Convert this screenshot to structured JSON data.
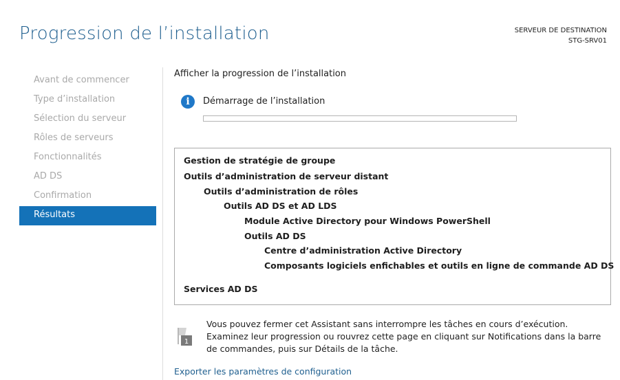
{
  "header": {
    "title": "Progression de l’installation",
    "server_label": "SERVEUR DE DESTINATION",
    "server_name": "STG-SRV01"
  },
  "nav": {
    "items": [
      {
        "label": "Avant de commencer"
      },
      {
        "label": "Type d’installation"
      },
      {
        "label": "Sélection du serveur"
      },
      {
        "label": "Rôles de serveurs"
      },
      {
        "label": "Fonctionnalités"
      },
      {
        "label": "AD DS"
      },
      {
        "label": "Confirmation"
      },
      {
        "label": "Résultats"
      }
    ],
    "active_index": 7
  },
  "main": {
    "section_label": "Afficher la progression de l’installation",
    "status_text": "Démarrage de l’installation",
    "progress": 0,
    "features": [
      {
        "label": "Gestion de stratégie de groupe",
        "level": 0
      },
      {
        "label": "Outils d’administration de serveur distant",
        "level": 0
      },
      {
        "label": "Outils d’administration de rôles",
        "level": 1
      },
      {
        "label": "Outils AD DS et AD LDS",
        "level": 2
      },
      {
        "label": "Module Active Directory pour Windows PowerShell",
        "level": 3
      },
      {
        "label": "Outils AD DS",
        "level": 3
      },
      {
        "label": "Centre d’administration Active Directory",
        "level": 4
      },
      {
        "label": "Composants logiciels enfichables et outils en ligne de commande AD DS",
        "level": 4
      },
      {
        "label": "Services AD DS",
        "level": 0
      }
    ],
    "note_badge": "1",
    "note_text": "Vous pouvez fermer cet Assistant sans interrompre les tâches en cours d’exécution. Examinez leur progression ou rouvrez cette page en cliquant sur Notifications dans la barre de commandes, puis sur Détails de la tâche.",
    "export_link": "Exporter les paramètres de configuration"
  },
  "colors": {
    "accent": "#1472b8",
    "title": "#1f5f8f",
    "nav_inactive": "#a9a9a9"
  },
  "icons": {
    "info": "info-icon",
    "note": "flag-icon"
  }
}
